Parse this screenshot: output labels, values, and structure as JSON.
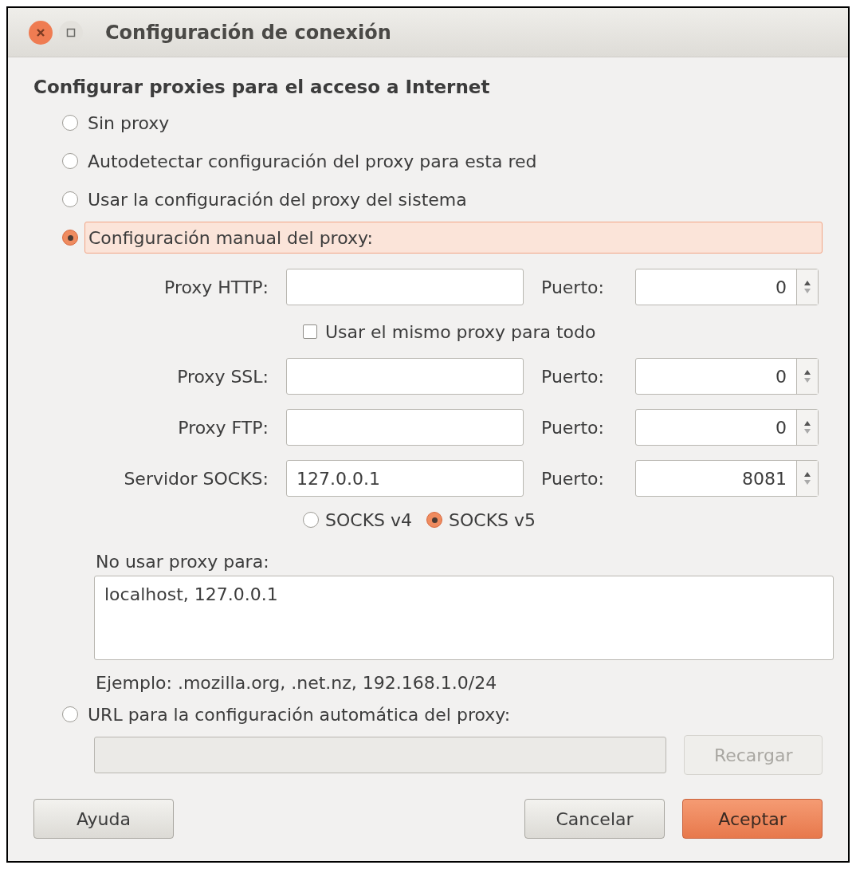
{
  "window": {
    "title": "Configuración de conexión"
  },
  "heading": "Configurar proxies para el acceso a Internet",
  "proxy_modes": [
    {
      "label": "Sin proxy",
      "selected": false,
      "kind": "plain"
    },
    {
      "label": "Autodetectar configuración del proxy para esta red",
      "selected": false,
      "kind": "plain"
    },
    {
      "label": "Usar la configuración del proxy del sistema",
      "selected": false,
      "kind": "plain"
    },
    {
      "label": "Configuración manual del proxy:",
      "selected": true,
      "kind": "manual"
    }
  ],
  "proxies": [
    {
      "label": "Proxy HTTP:",
      "port_label": "Puerto:",
      "port": "0"
    },
    {
      "label": "Proxy SSL:",
      "port_label": "Puerto:",
      "port": "0"
    },
    {
      "label": "Proxy FTP:",
      "port_label": "Puerto:",
      "port": "0"
    },
    {
      "label": "Servidor SOCKS:",
      "host": "127.0.0.1",
      "port_label": "Puerto:",
      "port": "8081"
    }
  ],
  "same_proxy": {
    "label": "Usar el mismo proxy para todo",
    "checked": false
  },
  "socks_versions": [
    {
      "label": "SOCKS v4",
      "selected": false
    },
    {
      "label": "SOCKS v5",
      "selected": true
    }
  ],
  "no_proxy": {
    "label": "No usar proxy para:",
    "value": "localhost, 127.0.0.1"
  },
  "example": "Ejemplo: .mozilla.org, .net.nz, 192.168.1.0/24",
  "auto_config": {
    "label": "URL para la configuración automática del proxy:",
    "selected": false,
    "url_disabled": true,
    "reload": {
      "label": "Recargar",
      "disabled": true
    }
  },
  "buttons": [
    {
      "label": "Ayuda",
      "kind": "default"
    },
    {
      "label": "Cancelar",
      "kind": "default"
    },
    {
      "label": "Aceptar",
      "kind": "primary"
    }
  ]
}
